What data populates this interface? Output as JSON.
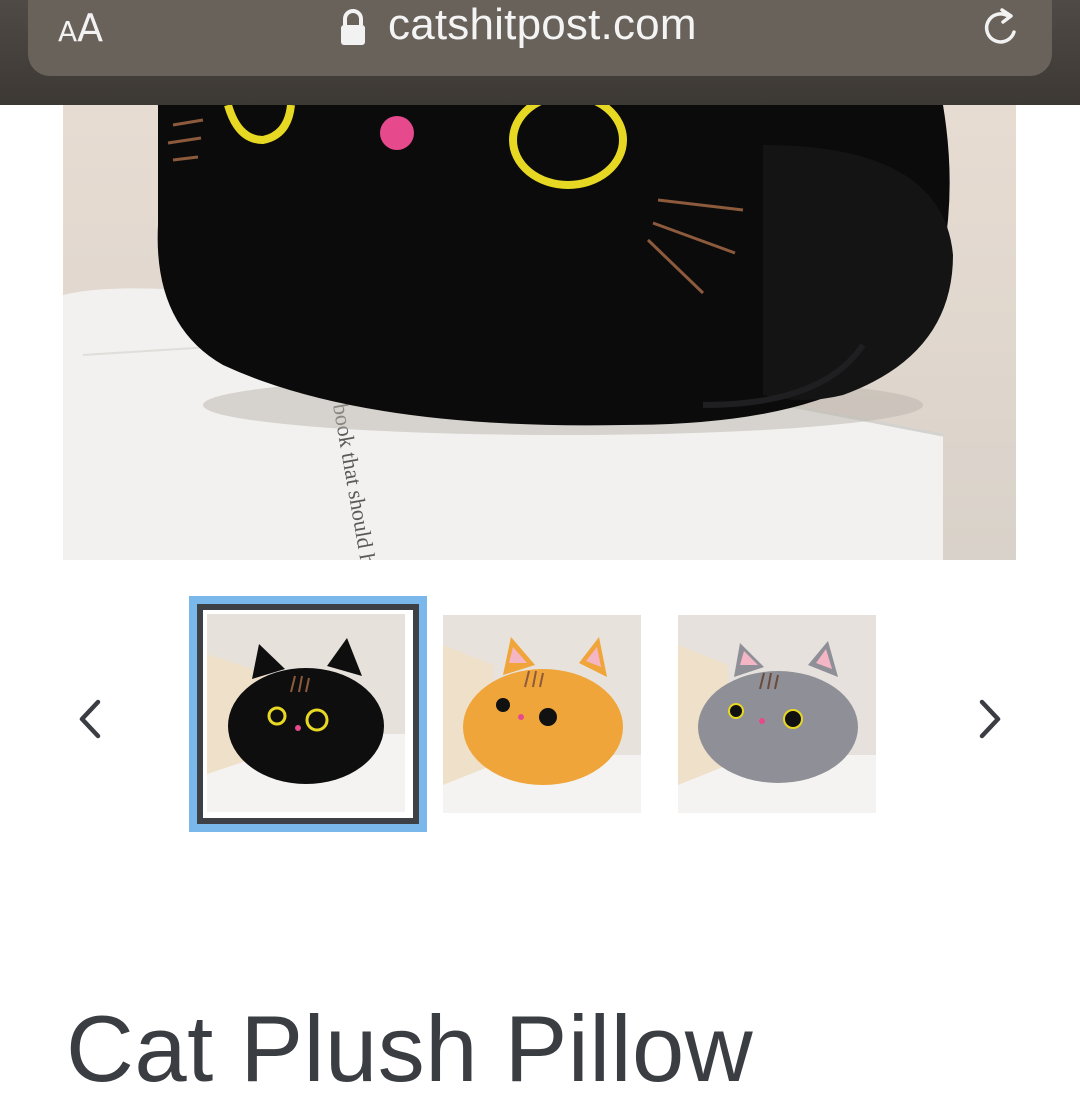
{
  "browser": {
    "text_size_label_small": "A",
    "text_size_label_large": "A",
    "url": "catshitpost.com",
    "icons": [
      "lock-icon",
      "reload-icon"
    ]
  },
  "gallery": {
    "selected_index": 0,
    "book_text": "book that should have bee",
    "thumbnails": [
      {
        "variant": "black",
        "body_color": "#111111",
        "selected": true
      },
      {
        "variant": "orange",
        "body_color": "#f0a53a",
        "selected": false
      },
      {
        "variant": "gray",
        "body_color": "#8f9097",
        "selected": false
      }
    ],
    "prev_icon": "chevron-left-icon",
    "next_icon": "chevron-right-icon",
    "selection_color": "#7ab8ec"
  },
  "product": {
    "title": "Cat Plush Pillow"
  }
}
